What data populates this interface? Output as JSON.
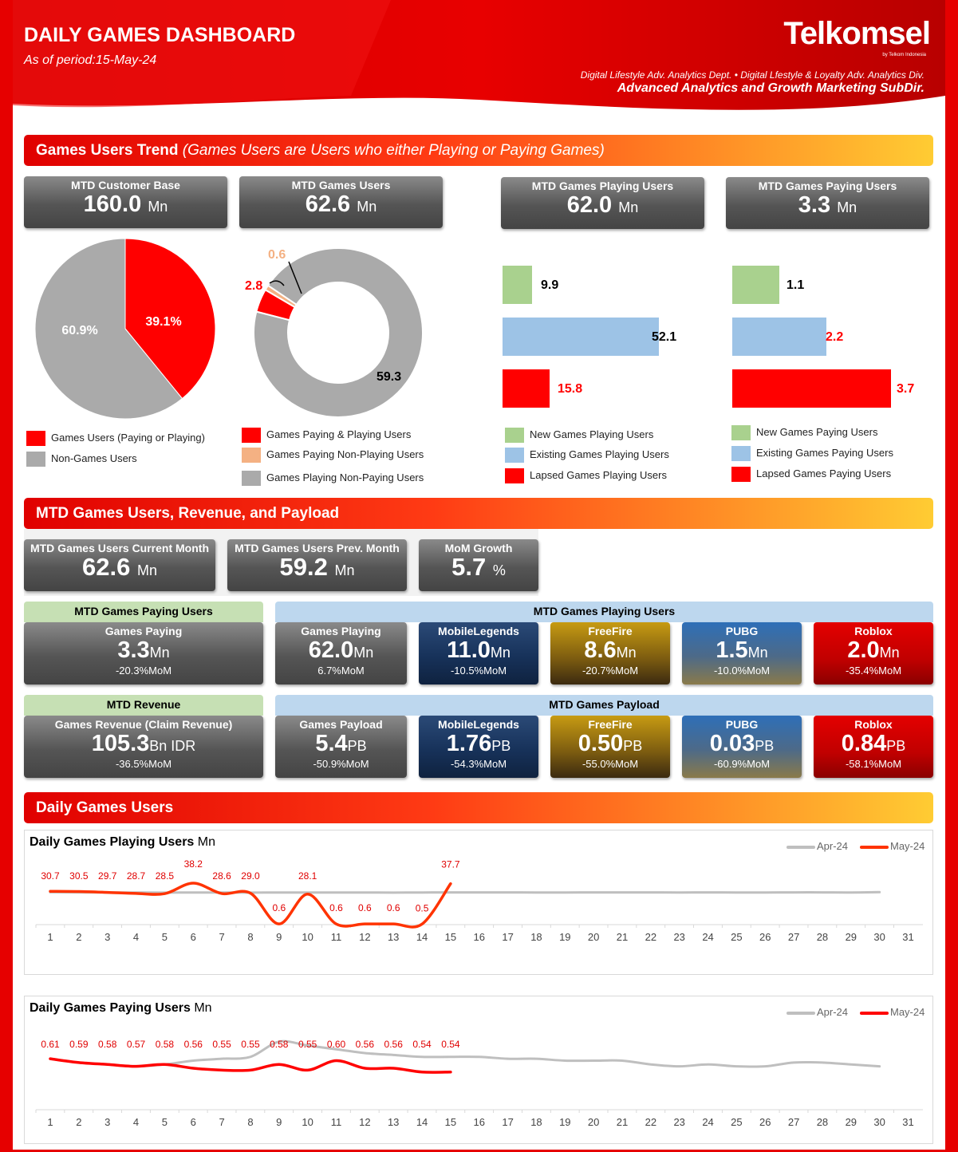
{
  "header": {
    "title": "DAILY GAMES DASHBOARD",
    "period": "As of period:15-May-24",
    "brand": "Telkomsel",
    "brand_sub": "by Telkom Indonesia",
    "dept": "Digital Lifestyle Adv. Analytics Dept. • Digital Lfestyle & Loyalty Adv. Analytics Div.",
    "subdir": "Advanced Analytics and Growth Marketing SubDir."
  },
  "colors": {
    "red": "#ff0000",
    "grey": "#aaaaaa",
    "green": "#a9d18e",
    "blue": "#9dc3e6",
    "peach": "#f4b183"
  },
  "sec1": {
    "title": "Games Users Trend",
    "subtitle": "(Games  Users are Users who either Playing or Paying Games)"
  },
  "kpi_top": [
    {
      "title": "MTD Customer Base",
      "value": "160.0",
      "unit": "Mn"
    },
    {
      "title": "MTD Games Users",
      "value": "62.6",
      "unit": "Mn"
    },
    {
      "title": "MTD Games Playing Users",
      "value": "62.0",
      "unit": "Mn"
    },
    {
      "title": "MTD Games Paying Users",
      "value": "3.3",
      "unit": "Mn"
    }
  ],
  "pie1": {
    "games": 39.1,
    "non_games": 60.9,
    "games_label": "39.1%",
    "non_games_label": "60.9%"
  },
  "pie1_legend": [
    "Games Users  (Paying or Playing)",
    "Non-Games Users"
  ],
  "donut": {
    "paying_playing": 2.8,
    "paying_nonplaying": 0.6,
    "playing_nonpaying": 59.3,
    "l1": "2.8",
    "l2": "0.6",
    "l3": "59.3"
  },
  "donut_legend": [
    "Games Paying  & Playing Users",
    "Games Paying Non-Playing Users",
    "Games Playing Non-Paying Users"
  ],
  "bars_playing": {
    "new": 9.9,
    "existing": 52.1,
    "lapsed": 15.8,
    "l_new": "9.9",
    "l_existing": "52.1",
    "l_lapsed": "15.8"
  },
  "bars_playing_legend": [
    "New Games Playing Users",
    "Existing Games Playing  Users",
    "Lapsed Games Playing Users"
  ],
  "bars_paying": {
    "new": 1.1,
    "existing": 2.2,
    "lapsed": 3.7,
    "l_new": "1.1",
    "l_existing": "2.2",
    "l_lapsed": "3.7"
  },
  "bars_paying_legend": [
    "New Games Paying Users",
    "Existing Games Paying  Users",
    "Lapsed Games Paying Users"
  ],
  "sec2": {
    "title": "MTD Games Users, Revenue, and Payload"
  },
  "kpi_mtd": [
    {
      "title": "MTD Games Users Current Month",
      "value": "62.6",
      "unit": "Mn"
    },
    {
      "title": "MTD Games Users Prev. Month",
      "value": "59.2",
      "unit": "Mn"
    },
    {
      "title": "MoM Growth",
      "value": "5.7",
      "unit": "%"
    }
  ],
  "band_paying": "MTD Games Paying Users",
  "band_playing": "MTD Games Playing Users",
  "band_revenue": "MTD Revenue",
  "band_payload": "MTD Games Payload",
  "paying_card": {
    "title": "Games Paying",
    "value": "3.3",
    "unit": "Mn",
    "growth": "-20.3%",
    "gunit": "MoM"
  },
  "playing_cards": [
    {
      "title": "Games Playing",
      "value": "62.0",
      "unit": "Mn",
      "growth": "6.7%",
      "gunit": "MoM"
    },
    {
      "title": "MobileLegends",
      "value": "11.0",
      "unit": "Mn",
      "growth": "-10.5%",
      "gunit": "MoM"
    },
    {
      "title": "FreeFire",
      "value": "8.6",
      "unit": "Mn",
      "growth": "-20.7%",
      "gunit": "MoM"
    },
    {
      "title": "PUBG",
      "value": "1.5",
      "unit": "Mn",
      "growth": "-10.0%",
      "gunit": "MoM"
    },
    {
      "title": "Roblox",
      "value": "2.0",
      "unit": "Mn",
      "growth": "-35.4%",
      "gunit": "MoM"
    }
  ],
  "revenue_card": {
    "title": "Games Revenue (Claim Revenue)",
    "value": "105.3",
    "unit": "Bn IDR",
    "growth": "-36.5%",
    "gunit": "MoM"
  },
  "payload_cards": [
    {
      "title": "Games Payload",
      "value": "5.4",
      "unit": "PB",
      "growth": "-50.9%",
      "gunit": "MoM"
    },
    {
      "title": "MobileLegends",
      "value": "1.76",
      "unit": "PB",
      "growth": "-54.3%",
      "gunit": "MoM"
    },
    {
      "title": "FreeFire",
      "value": "0.50",
      "unit": "PB",
      "growth": "-55.0%",
      "gunit": "MoM"
    },
    {
      "title": "PUBG",
      "value": "0.03",
      "unit": "PB",
      "growth": "-60.9%",
      "gunit": "MoM"
    },
    {
      "title": "Roblox",
      "value": "0.84",
      "unit": "PB",
      "growth": "-58.1%",
      "gunit": "MoM"
    }
  ],
  "sec3": {
    "title": "Daily Games Users"
  },
  "chart_data": [
    {
      "type": "line",
      "title": "Daily Games Playing Users",
      "title_unit": "Mn",
      "x": [
        1,
        2,
        3,
        4,
        5,
        6,
        7,
        8,
        9,
        10,
        11,
        12,
        13,
        14,
        15,
        16,
        17,
        18,
        19,
        20,
        21,
        22,
        23,
        24,
        25,
        26,
        27,
        28,
        29,
        30,
        31
      ],
      "series": [
        {
          "name": "Apr-24",
          "color": "#bfbfbf",
          "values": [
            29.8,
            29.7,
            29.6,
            29.6,
            29.5,
            29.6,
            29.6,
            29.5,
            29.6,
            29.6,
            29.6,
            29.6,
            29.5,
            29.6,
            29.7,
            29.7,
            29.7,
            29.6,
            29.6,
            29.7,
            29.7,
            29.7,
            29.6,
            29.7,
            29.6,
            29.6,
            29.7,
            29.7,
            29.6,
            29.9,
            null
          ]
        },
        {
          "name": "May-24",
          "color": "#ff3300",
          "values": [
            30.7,
            30.5,
            29.7,
            28.7,
            28.5,
            38.2,
            28.6,
            29.0,
            0.6,
            28.1,
            0.6,
            0.6,
            0.6,
            0.5,
            37.7
          ],
          "labels": [
            "30.7",
            "30.5",
            "29.7",
            "28.7",
            "28.5",
            "38.2",
            "28.6",
            "29.0",
            "0.6",
            "28.1",
            "0.6",
            "0.6",
            "0.6",
            "0.5",
            "37.7"
          ]
        }
      ]
    },
    {
      "type": "line",
      "title": "Daily Games Paying Users",
      "title_unit": "Mn",
      "x": [
        1,
        2,
        3,
        4,
        5,
        6,
        7,
        8,
        9,
        10,
        11,
        12,
        13,
        14,
        15,
        16,
        17,
        18,
        19,
        20,
        21,
        22,
        23,
        24,
        25,
        26,
        27,
        28,
        29,
        30,
        31
      ],
      "series": [
        {
          "name": "Apr-24",
          "color": "#bfbfbf",
          "values": [
            0.61,
            0.59,
            0.58,
            0.57,
            0.58,
            0.6,
            0.61,
            0.62,
            0.7,
            0.68,
            0.66,
            0.64,
            0.63,
            0.62,
            0.62,
            0.62,
            0.61,
            0.61,
            0.6,
            0.6,
            0.6,
            0.58,
            0.57,
            0.58,
            0.57,
            0.57,
            0.59,
            0.59,
            0.58,
            0.57,
            null
          ]
        },
        {
          "name": "May-24",
          "color": "#ff0000",
          "values": [
            0.61,
            0.59,
            0.58,
            0.57,
            0.58,
            0.56,
            0.55,
            0.55,
            0.58,
            0.55,
            0.6,
            0.56,
            0.56,
            0.54,
            0.54
          ],
          "labels": [
            "0.61",
            "0.59",
            "0.58",
            "0.57",
            "0.58",
            "0.56",
            "0.55",
            "0.55",
            "0.58",
            "0.55",
            "0.60",
            "0.56",
            "0.56",
            "0.54",
            "0.54"
          ]
        }
      ]
    }
  ]
}
